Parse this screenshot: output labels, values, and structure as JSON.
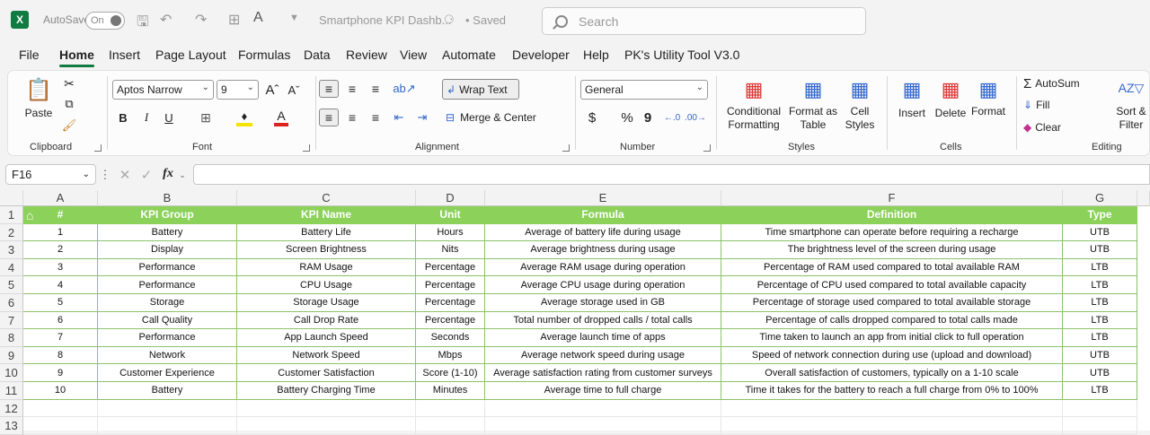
{
  "titlebar": {
    "logo": "X",
    "autosave_label": "AutoSave",
    "autosave_state": "On",
    "doc_title": "Smartphone KPI Dashb...",
    "saved_status": "• Saved",
    "search_placeholder": "Search"
  },
  "menu": [
    "File",
    "Home",
    "Insert",
    "Page Layout",
    "Formulas",
    "Data",
    "Review",
    "View",
    "Automate",
    "Developer",
    "Help",
    "PK's Utility Tool V3.0"
  ],
  "ribbon": {
    "paste": "Paste",
    "clipboard": "Clipboard",
    "font_name": "Aptos Narrow",
    "font_size": "9",
    "bold": "B",
    "italic": "I",
    "underline": "U",
    "font": "Font",
    "wrap_text": "Wrap Text",
    "merge_center": "Merge & Center",
    "alignment": "Alignment",
    "number_format": "General",
    "currency": "$",
    "percent": "%",
    "comma": "9",
    "number": "Number",
    "conditional_formatting": "Conditional Formatting",
    "format_as_table": "Format as Table",
    "cell_styles": "Cell Styles",
    "styles": "Styles",
    "insert": "Insert",
    "delete": "Delete",
    "format": "Format",
    "cells": "Cells",
    "autosum": "AutoSum",
    "fill": "Fill",
    "clear": "Clear",
    "sort_filter": "Sort & Filter",
    "editing": "Editing"
  },
  "formula_bar": {
    "name_box": "F16",
    "fx": "fx",
    "value": ""
  },
  "sheet": {
    "columns": [
      "A",
      "B",
      "C",
      "D",
      "E",
      "F",
      "G"
    ],
    "row_numbers": [
      "1",
      "2",
      "3",
      "4",
      "5",
      "6",
      "7",
      "8",
      "9",
      "10",
      "11",
      "12",
      "13"
    ],
    "header": [
      "#",
      "KPI Group",
      "KPI Name",
      "Unit",
      "Formula",
      "Definition",
      "Type"
    ],
    "rows": [
      [
        "1",
        "Battery",
        "Battery Life",
        "Hours",
        "Average of battery life during usage",
        "Time smartphone can operate before requiring a recharge",
        "UTB"
      ],
      [
        "2",
        "Display",
        "Screen Brightness",
        "Nits",
        "Average brightness during usage",
        "The brightness level of the screen during usage",
        "UTB"
      ],
      [
        "3",
        "Performance",
        "RAM Usage",
        "Percentage",
        "Average RAM usage during operation",
        "Percentage of RAM used compared to total available RAM",
        "LTB"
      ],
      [
        "4",
        "Performance",
        "CPU Usage",
        "Percentage",
        "Average CPU usage during operation",
        "Percentage of CPU used compared to total available capacity",
        "LTB"
      ],
      [
        "5",
        "Storage",
        "Storage Usage",
        "Percentage",
        "Average storage used in GB",
        "Percentage of storage used compared to total available storage",
        "LTB"
      ],
      [
        "6",
        "Call Quality",
        "Call Drop Rate",
        "Percentage",
        "Total number of dropped calls / total calls",
        "Percentage of calls dropped compared to total calls made",
        "LTB"
      ],
      [
        "7",
        "Performance",
        "App Launch Speed",
        "Seconds",
        "Average launch time of apps",
        "Time taken to launch an app from initial click to full operation",
        "LTB"
      ],
      [
        "8",
        "Network",
        "Network Speed",
        "Mbps",
        "Average network speed during usage",
        "Speed of network connection during use (upload and download)",
        "UTB"
      ],
      [
        "9",
        "Customer Experience",
        "Customer Satisfaction",
        "Score (1-10)",
        "Average satisfaction rating from customer surveys",
        "Overall satisfaction of customers, typically on a 1-10 scale",
        "UTB"
      ],
      [
        "10",
        "Battery",
        "Battery Charging Time",
        "Minutes",
        "Average time to full charge",
        "Time it takes for the battery to reach a full charge from 0% to 100%",
        "LTB"
      ]
    ]
  },
  "colors": {
    "header_fill": "#8bd15a",
    "accent": "#107c41"
  }
}
